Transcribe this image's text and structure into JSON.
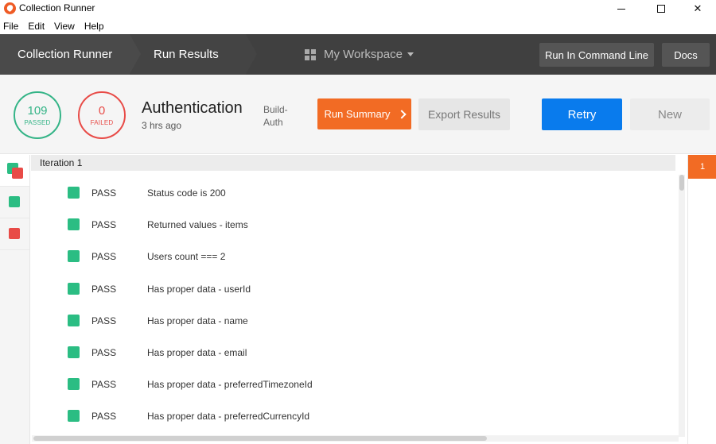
{
  "window": {
    "title": "Collection Runner",
    "controls": {
      "minimize": "",
      "maximize": "",
      "close": "✕"
    }
  },
  "menu": [
    "File",
    "Edit",
    "View",
    "Help"
  ],
  "header": {
    "breadcrumb_1": "Collection Runner",
    "breadcrumb_2": "Run Results",
    "workspace": "My Workspace",
    "run_cmd_button": "Run In Command Line",
    "docs_button": "Docs"
  },
  "summary": {
    "passed_count": "109",
    "passed_label": "PASSED",
    "failed_count": "0",
    "failed_label": "FAILED",
    "run_name": "Authentication",
    "run_time": "3 hrs ago",
    "environment": "Build-Auth",
    "run_summary_button": "Run Summary",
    "export_button": "Export Results",
    "retry_button": "Retry",
    "new_button": "New"
  },
  "colors": {
    "pass": "#2bbd83",
    "fail": "#e84b47",
    "accent": "#f26b24",
    "primary": "#097bed"
  },
  "iteration": {
    "header": "Iteration 1",
    "badge": "1"
  },
  "tests": [
    {
      "status": "PASS",
      "name": "Status code is 200"
    },
    {
      "status": "PASS",
      "name": "Returned values - items"
    },
    {
      "status": "PASS",
      "name": "Users count === 2"
    },
    {
      "status": "PASS",
      "name": "Has proper data - userId"
    },
    {
      "status": "PASS",
      "name": "Has proper data - name"
    },
    {
      "status": "PASS",
      "name": "Has proper data - email"
    },
    {
      "status": "PASS",
      "name": "Has proper data - preferredTimezoneId"
    },
    {
      "status": "PASS",
      "name": "Has proper data - preferredCurrencyId"
    }
  ]
}
